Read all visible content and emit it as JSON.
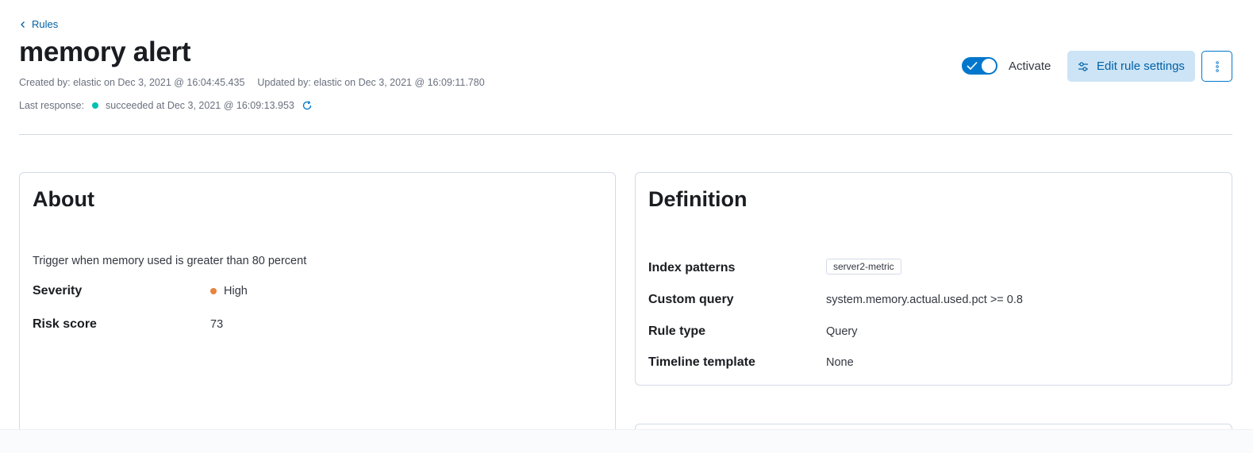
{
  "breadcrumb": {
    "label": "Rules"
  },
  "rule": {
    "title": "memory alert",
    "created": "Created by: elastic on Dec 3, 2021 @ 16:04:45.435",
    "updated": "Updated by: elastic on Dec 3, 2021 @ 16:09:11.780",
    "last_response_label": "Last response:",
    "last_response_status": "succeeded at Dec 3, 2021 @ 16:09:13.953",
    "status_color": "#00bfb3"
  },
  "header_actions": {
    "activate_label": "Activate",
    "activate_state": true,
    "edit_label": "Edit rule settings"
  },
  "about": {
    "title": "About",
    "description": "Trigger when memory used is greater than 80 percent",
    "fields": [
      {
        "label": "Severity",
        "value": "High",
        "color": "#e7843f"
      },
      {
        "label": "Risk score",
        "value": "73"
      }
    ]
  },
  "definition": {
    "title": "Definition",
    "fields": [
      {
        "label": "Index patterns",
        "value": "server2-metric"
      },
      {
        "label": "Custom query",
        "value": "system.memory.actual.used.pct >= 0.8"
      },
      {
        "label": "Rule type",
        "value": "Query"
      },
      {
        "label": "Timeline template",
        "value": "None"
      }
    ]
  },
  "icons": {
    "breadcrumb": "chevron-left-icon",
    "refresh": "refresh-icon",
    "edit": "controls-icon",
    "more": "vertical-ellipsis-icon"
  }
}
